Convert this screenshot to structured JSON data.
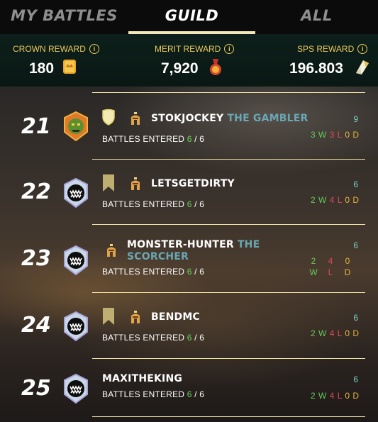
{
  "tabs": [
    {
      "label": "MY BATTLES",
      "active": false
    },
    {
      "label": "GUILD",
      "active": true
    },
    {
      "label": "ALL",
      "active": false
    }
  ],
  "rewards": {
    "crown": {
      "label": "CROWN REWARD",
      "value": "180",
      "icon": "crown-coin-icon"
    },
    "merit": {
      "label": "MERIT REWARD",
      "value": "7,920",
      "icon": "merit-medal-icon"
    },
    "sps": {
      "label": "SPS REWARD",
      "value": "196.803",
      "icon": "sps-crystal-icon"
    },
    "info_glyph": "i"
  },
  "colors": {
    "gold": "#e8c95b",
    "win": "#63c95a",
    "loss": "#e1475a",
    "draw": "#e8b240",
    "title": "#69a7b4",
    "total": "#7ad1c6"
  },
  "rows": [
    {
      "rank": "21",
      "name": "STOKJOCKEY",
      "title": "THE GAMBLER",
      "entered_label": "BATTLES ENTERED",
      "entered": "6",
      "sep": "/",
      "max": "6",
      "total": "9",
      "w": "3",
      "l": "3",
      "d": "0",
      "avatar": "orc-avatar-icon",
      "badge": "shield-badge-icon",
      "helm": true
    },
    {
      "rank": "22",
      "name": "LETSGETDIRTY",
      "title": "",
      "entered_label": "BATTLES ENTERED",
      "entered": "6",
      "sep": "/",
      "max": "6",
      "total": "6",
      "w": "2",
      "l": "4",
      "d": "0",
      "avatar": "monster-avatar-icon",
      "badge": "banner-badge-icon",
      "helm": true
    },
    {
      "rank": "23",
      "name": "MONSTER-HUNTER",
      "title": "THE SCORCHER",
      "entered_label": "BATTLES ENTERED",
      "entered": "6",
      "sep": "/",
      "max": "6",
      "total": "6",
      "w": "2",
      "l": "4",
      "d": "0",
      "avatar": "monster-avatar-icon",
      "badge": "",
      "helm": true
    },
    {
      "rank": "24",
      "name": "BENDMC",
      "title": "",
      "entered_label": "BATTLES ENTERED",
      "entered": "6",
      "sep": "/",
      "max": "6",
      "total": "6",
      "w": "2",
      "l": "4",
      "d": "0",
      "avatar": "monster-avatar-icon",
      "badge": "banner-badge-icon",
      "helm": true
    },
    {
      "rank": "25",
      "name": "MAXITHEKING",
      "title": "",
      "entered_label": "BATTLES ENTERED",
      "entered": "6",
      "sep": "/",
      "max": "6",
      "total": "6",
      "w": "2",
      "l": "4",
      "d": "0",
      "avatar": "monster-avatar-icon",
      "badge": "",
      "helm": false
    }
  ],
  "wld_letters": {
    "w": "W",
    "l": "L",
    "d": "D"
  }
}
